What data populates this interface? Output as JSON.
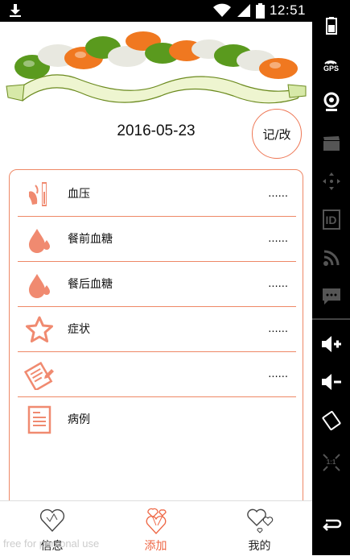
{
  "status_bar": {
    "time": "12:51",
    "icons": [
      "download-icon",
      "wifi-icon",
      "signal-icon",
      "battery-icon"
    ]
  },
  "emulator_sidebar": {
    "gps_label": "GPS",
    "id_label": "ID",
    "ratio_label": "1:1"
  },
  "record": {
    "date": "2016-05-23",
    "edit_button": "记/改"
  },
  "items": [
    {
      "label": "血压",
      "value": "......",
      "icon": "blood-pressure-icon"
    },
    {
      "label": "餐前血糖",
      "value": "......",
      "icon": "blood-drop-icon"
    },
    {
      "label": "餐后血糖",
      "value": "......",
      "icon": "blood-drop-icon"
    },
    {
      "label": "症状",
      "value": "......",
      "icon": "star-icon"
    },
    {
      "label": "",
      "value": "......",
      "icon": "notes-pencil-icon"
    },
    {
      "label": "病例",
      "value": "",
      "icon": "document-icon"
    }
  ],
  "tabs": [
    {
      "label": "信息",
      "icon": "heart-outline-icon",
      "active": false
    },
    {
      "label": "添加",
      "icon": "hearts-bouquet-icon",
      "active": true
    },
    {
      "label": "我的",
      "icon": "two-hearts-icon",
      "active": false
    }
  ],
  "watermark": "free for personal use",
  "colors": {
    "accent": "#ee7755",
    "tab_active": "#ee6644"
  }
}
